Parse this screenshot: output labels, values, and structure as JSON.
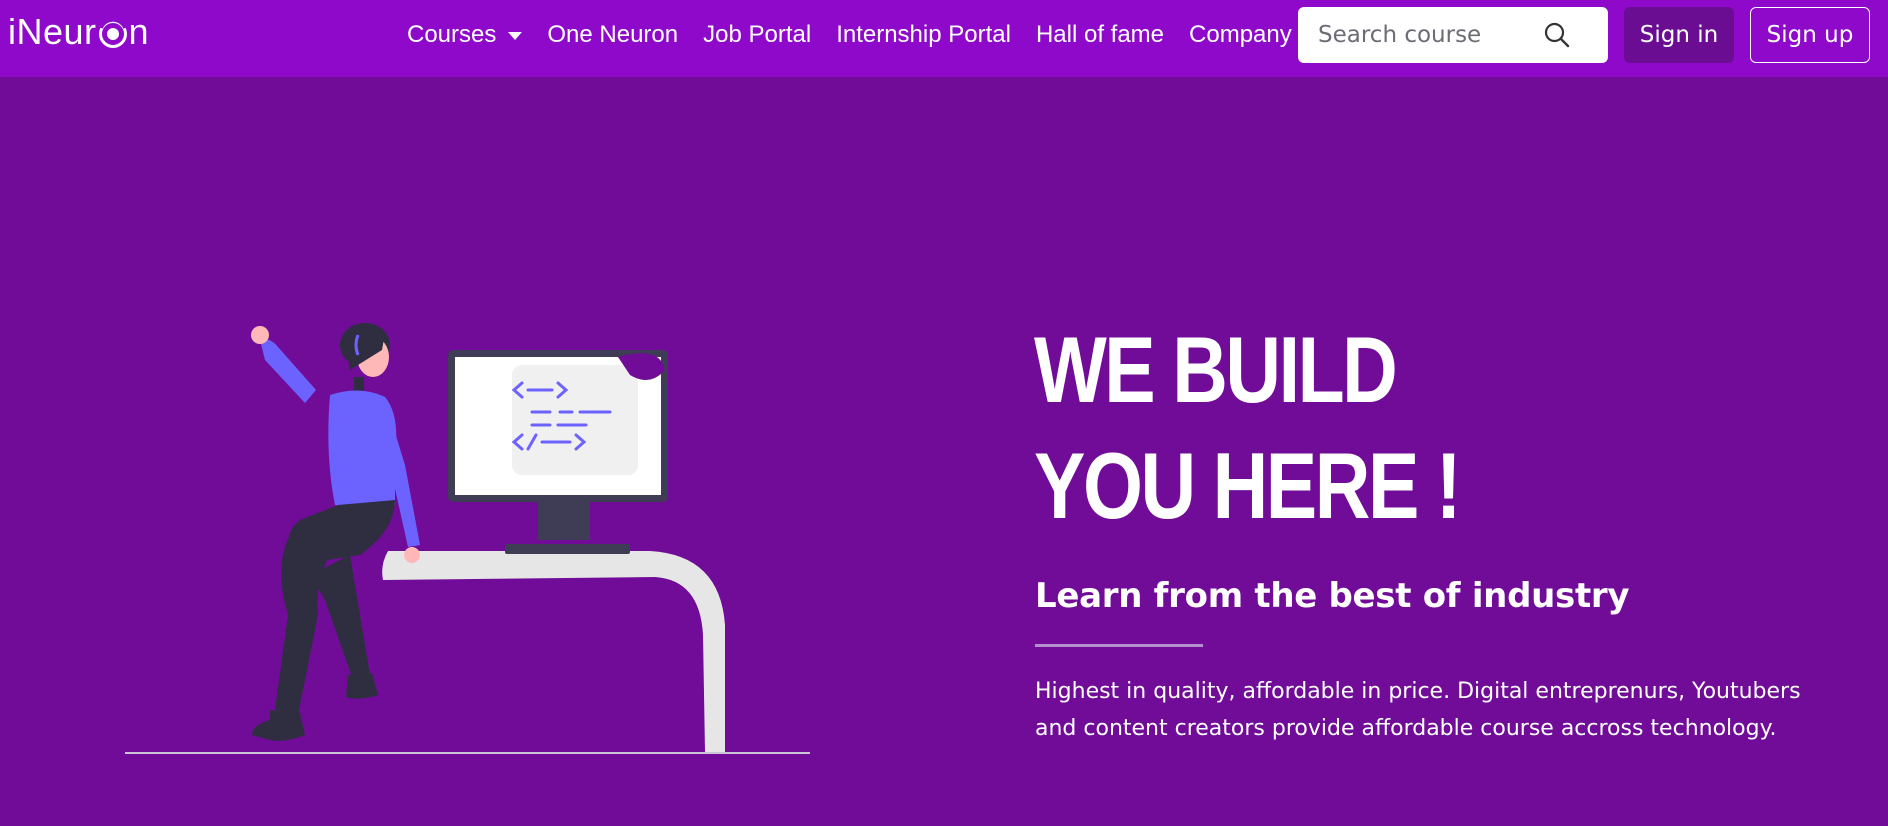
{
  "brand": {
    "logo_text_start": "iNeur",
    "logo_text_end": "n"
  },
  "nav": {
    "items": [
      {
        "label": "Courses",
        "has_dropdown": true
      },
      {
        "label": "One Neuron",
        "has_dropdown": false
      },
      {
        "label": "Job Portal",
        "has_dropdown": false
      },
      {
        "label": "Internship Portal",
        "has_dropdown": false
      },
      {
        "label": "Hall of fame",
        "has_dropdown": false
      },
      {
        "label": "Company",
        "has_dropdown": true
      }
    ],
    "search": {
      "placeholder": "Search course",
      "value": ""
    },
    "signin_label": "Sign in",
    "signup_label": "Sign up"
  },
  "hero": {
    "headline_line1": "WE BUILD",
    "headline_line2": "YOU HERE !",
    "subtitle": "Learn from the best of industry",
    "description": "Highest in quality, affordable in price. Digital entreprenurs, Youtubers and content creators provide affordable course accross technology."
  },
  "colors": {
    "navbar_bg": "#8e09c9",
    "page_bg": "#700c97",
    "signin_bg": "#6b0d92",
    "illustration_accent": "#6c63ff",
    "text": "#ffffff"
  },
  "icons": {
    "search": "search-icon",
    "dropdown": "chevron-down-icon"
  }
}
